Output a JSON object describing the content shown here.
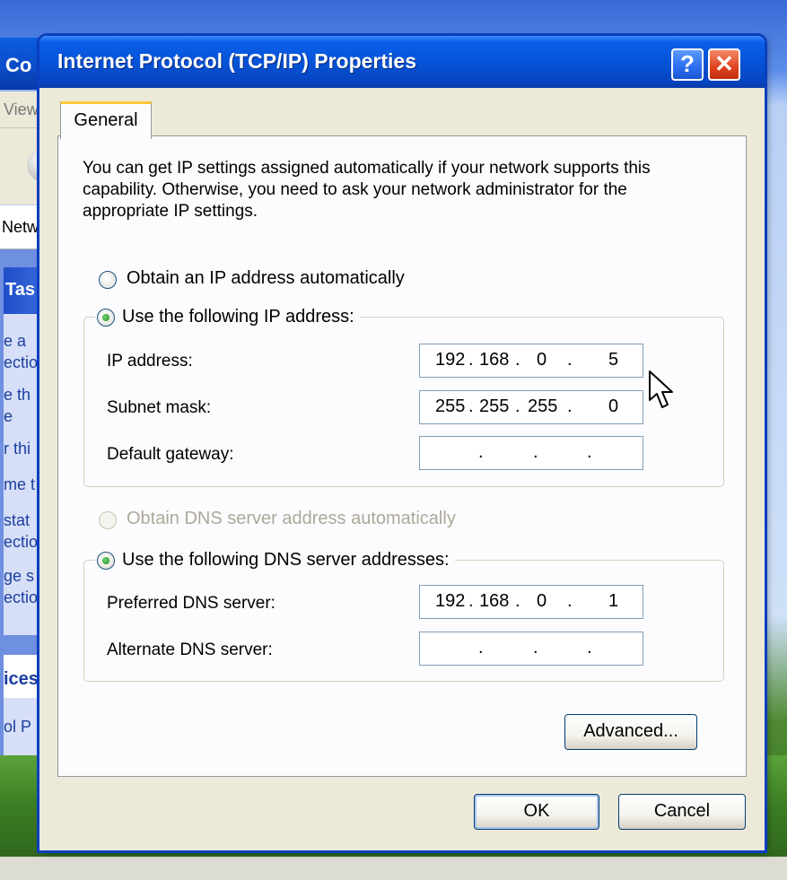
{
  "background_window": {
    "title_fragment": "Co",
    "menu_fragment": "View",
    "address_fragment": "Netw",
    "tasks_header_fragment": "Tas",
    "task_links": [
      "e a",
      "ectio",
      "e th",
      "e",
      "r thi",
      "me t",
      "stat",
      "ectio",
      "ge s",
      "ectio"
    ],
    "see_also_header_fragment": "ices",
    "see_also_link_fragment": "ol P"
  },
  "dialog": {
    "title": "Internet Protocol (TCP/IP) Properties",
    "help_glyph": "?",
    "close_glyph": "✕",
    "tab_label": "General",
    "intro_text": "You can get IP settings assigned automatically if your network supports this capability. Otherwise, you need to ask your network administrator for the appropriate IP settings.",
    "ip_auto_label": "Obtain an IP address automatically",
    "ip_manual_label": "Use the following IP address:",
    "ip_address_label": "IP address:",
    "ip_address_octets": [
      "192",
      "168",
      "0",
      "5"
    ],
    "subnet_label": "Subnet mask:",
    "subnet_octets": [
      "255",
      "255",
      "255",
      "0"
    ],
    "gateway_label": "Default gateway:",
    "gateway_octets": [
      "",
      "",
      "",
      ""
    ],
    "dns_auto_label": "Obtain DNS server address automatically",
    "dns_manual_label": "Use the following DNS server addresses:",
    "preferred_dns_label": "Preferred DNS server:",
    "preferred_dns_octets": [
      "192",
      "168",
      "0",
      "1"
    ],
    "alternate_dns_label": "Alternate DNS server:",
    "alternate_dns_octets": [
      "",
      "",
      "",
      ""
    ],
    "advanced_label": "Advanced...",
    "ok_label": "OK",
    "cancel_label": "Cancel"
  },
  "colors": {
    "titlebar_blue": "#0653d8",
    "dialog_face": "#ece9d8",
    "radio_dot": "#1f8a1f",
    "close_red": "#e0431f"
  }
}
